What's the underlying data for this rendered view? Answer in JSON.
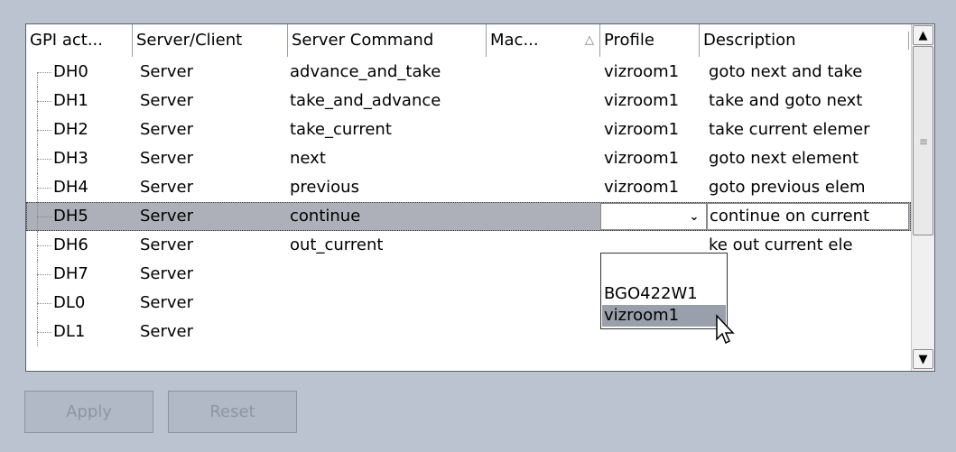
{
  "columns": [
    {
      "label": "GPI act..."
    },
    {
      "label": "Server/Client"
    },
    {
      "label": "Server Command"
    },
    {
      "label": "Mac..."
    },
    {
      "label": "Profile"
    },
    {
      "label": "Description"
    }
  ],
  "sort_indicator": "△",
  "rows": [
    {
      "gpi": "DH0",
      "sc": "Server",
      "cmd": "advance_and_take",
      "profile": "vizroom1",
      "desc": "goto next and take"
    },
    {
      "gpi": "DH1",
      "sc": "Server",
      "cmd": "take_and_advance",
      "profile": "vizroom1",
      "desc": "take and goto next"
    },
    {
      "gpi": "DH2",
      "sc": "Server",
      "cmd": "take_current",
      "profile": "vizroom1",
      "desc": "take current elemer"
    },
    {
      "gpi": "DH3",
      "sc": "Server",
      "cmd": "next",
      "profile": "vizroom1",
      "desc": "goto next element"
    },
    {
      "gpi": "DH4",
      "sc": "Server",
      "cmd": "previous",
      "profile": "vizroom1",
      "desc": "goto previous elem"
    },
    {
      "gpi": "DH5",
      "sc": "Server",
      "cmd": "continue",
      "profile": "",
      "desc": "continue on current"
    },
    {
      "gpi": "DH6",
      "sc": "Server",
      "cmd": "out_current",
      "profile": "",
      "desc": "ke out current ele"
    },
    {
      "gpi": "DH7",
      "sc": "Server",
      "cmd": "",
      "profile": "",
      "desc": ""
    },
    {
      "gpi": "DL0",
      "sc": "Server",
      "cmd": "",
      "profile": "",
      "desc": ""
    },
    {
      "gpi": "DL1",
      "sc": "Server",
      "cmd": "",
      "profile": "",
      "desc": ""
    }
  ],
  "selected_row": "DH5",
  "profile_options": [
    "BGO422W1",
    "vizroom1"
  ],
  "highlighted_option": "vizroom1",
  "buttons": {
    "apply": "Apply",
    "reset": "Reset"
  },
  "scrollbar": {
    "up_icon": "▲",
    "down_icon": "▼",
    "grip": "≡"
  }
}
